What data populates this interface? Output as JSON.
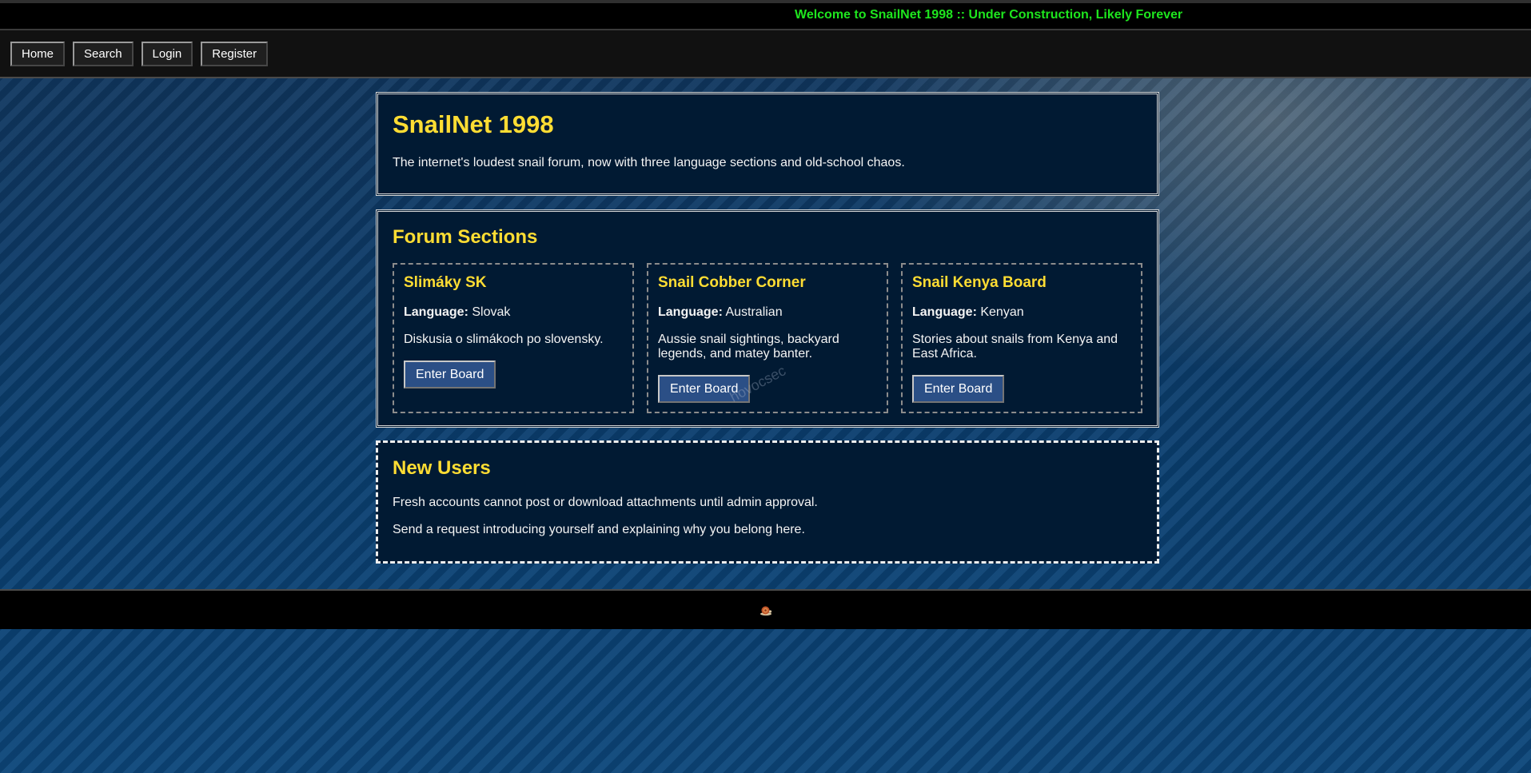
{
  "banner": {
    "marquee_text": "Welcome to SnailNet 1998 :: Under Construction, Likely Forever"
  },
  "nav": {
    "items": [
      {
        "label": "Home"
      },
      {
        "label": "Search"
      },
      {
        "label": "Login"
      },
      {
        "label": "Register"
      }
    ]
  },
  "hero": {
    "title": "SnailNet 1998",
    "description": "The internet's loudest snail forum, now with three language sections and old-school chaos."
  },
  "forum_sections": {
    "title": "Forum Sections",
    "language_label": "Language:",
    "boards": [
      {
        "name": "Slimáky SK",
        "language": "Slovak",
        "description": "Diskusia o slimákoch po slovensky.",
        "button_label": "Enter Board"
      },
      {
        "name": "Snail Cobber Corner",
        "language": "Australian",
        "description": "Aussie snail sightings, backyard legends, and matey banter.",
        "button_label": "Enter Board"
      },
      {
        "name": "Snail Kenya Board",
        "language": "Kenyan",
        "description": "Stories about snails from Kenya and East Africa.",
        "button_label": "Enter Board"
      }
    ]
  },
  "new_users": {
    "title": "New Users",
    "lines": [
      "Fresh accounts cannot post or download attachments until admin approval.",
      "Send a request introducing yourself and explaining why you belong here."
    ]
  },
  "watermark": "hovocsec",
  "footer": {
    "icon": "snail-icon"
  },
  "colors": {
    "accent_yellow": "#ffdd33",
    "marquee_green": "#1ee61e",
    "button_blue": "#2b4f86",
    "panel_bg": "#011a33"
  }
}
